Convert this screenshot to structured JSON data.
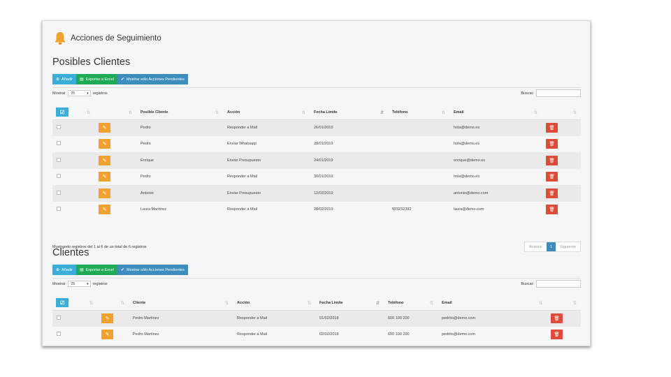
{
  "header": {
    "title": "Acciones de Seguimiento"
  },
  "prospects": {
    "title": "Posibles Clientes",
    "buttons": {
      "add": "Añadir",
      "export": "Exportar a Excel",
      "pending": "Mostrar sólo Acciones Pendientes"
    },
    "length": {
      "label_before": "Mostrar",
      "value": "25",
      "label_after": "registros"
    },
    "search_label": "Buscar:",
    "columns": [
      "Posible Cliente",
      "Acción",
      "Fecha Límite",
      "Teléfono",
      "Email"
    ],
    "rows": [
      {
        "name": "Pedro",
        "action": "Responder a Mail",
        "date": "26/01/2019",
        "phone": "",
        "email": "hola@demo.es"
      },
      {
        "name": "Pedro",
        "action": "Enviar Whatsapp",
        "date": "28/01/2019",
        "phone": "",
        "email": "hola@demo.es"
      },
      {
        "name": "Enrique",
        "action": "Enviar Presupuesto",
        "date": "24/01/2019",
        "phone": "",
        "email": "enrique@demo.es"
      },
      {
        "name": "Pedro",
        "action": "Responder a Mail",
        "date": "30/01/2019",
        "phone": "",
        "email": "hola@demo.es"
      },
      {
        "name": "Antonio",
        "action": "Enviar Presupuesto",
        "date": "12/02/2019",
        "phone": "",
        "email": "antonio@demo.com"
      },
      {
        "name": "Laura Martínez",
        "action": "Responder a Mail",
        "date": "28/02/2019",
        "phone": "923232392",
        "email": "laura@demo.com"
      }
    ],
    "info": "Mostrando registros del 1 al 6 de un total de 6 registros",
    "pager": {
      "prev": "Anterior",
      "page": "1",
      "next": "Siguiente"
    }
  },
  "clients": {
    "title": "Clientes",
    "buttons": {
      "add": "Añadir",
      "export": "Exportar a Excel",
      "pending": "Mostrar sólo Acciones Pendientes"
    },
    "length": {
      "label_before": "Mostrar",
      "value": "25",
      "label_after": "registros"
    },
    "search_label": "Buscar:",
    "columns": [
      "Cliente",
      "Acción",
      "Fecha Límite",
      "Teléfono",
      "Email"
    ],
    "rows": [
      {
        "name": "Pedro Martínez",
        "action": "Responder a Mail",
        "date": "01/02/2018",
        "phone": "600 100 200",
        "email": "pedrito@demo.com"
      },
      {
        "name": "Pedro Martínez",
        "action": "Responder a Mail",
        "date": "02/02/2018",
        "phone": "600 100 200",
        "email": "pedrito@demo.com"
      }
    ]
  },
  "colors": {
    "info": "#3aaed8",
    "success": "#1fab55",
    "primary": "#3d8dbd",
    "warning": "#f0a22e",
    "danger": "#dd4b39",
    "bell": "#f0a22e"
  },
  "icons": {
    "bell": "bell-icon",
    "edit": "pencil-icon",
    "delete": "trash-icon",
    "check": "check-icon",
    "add": "plus-circle-icon",
    "export": "file-excel-icon",
    "sort": "sort-icon"
  }
}
